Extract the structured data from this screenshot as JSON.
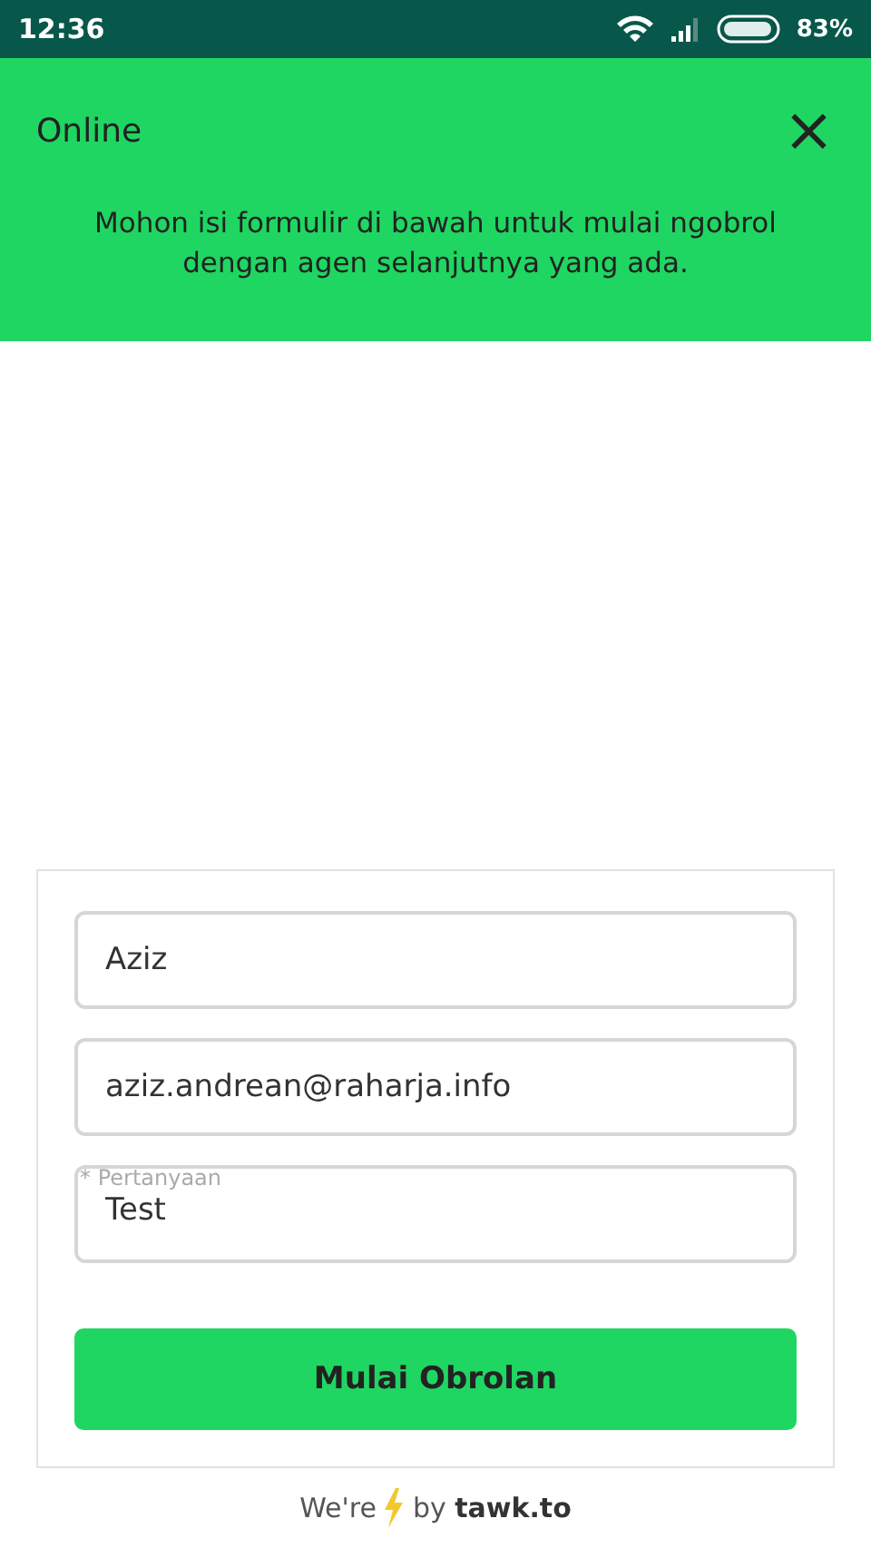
{
  "status_bar": {
    "time": "12:36",
    "battery": "83%"
  },
  "header": {
    "title": "Online",
    "close": "×",
    "message": "Mohon isi formulir di bawah untuk mulai ngobrol dengan agen selanjutnya yang ada."
  },
  "form": {
    "fields": [
      {
        "value": "Aziz"
      },
      {
        "value": "aziz.andrean@raharja.info"
      },
      {
        "label": "* Pertanyaan",
        "value": "Test",
        "focused": true
      }
    ],
    "submit": "Mulai Obrolan"
  },
  "footer": {
    "lead": "We're",
    "credit": "by **tawk.to**"
  }
}
